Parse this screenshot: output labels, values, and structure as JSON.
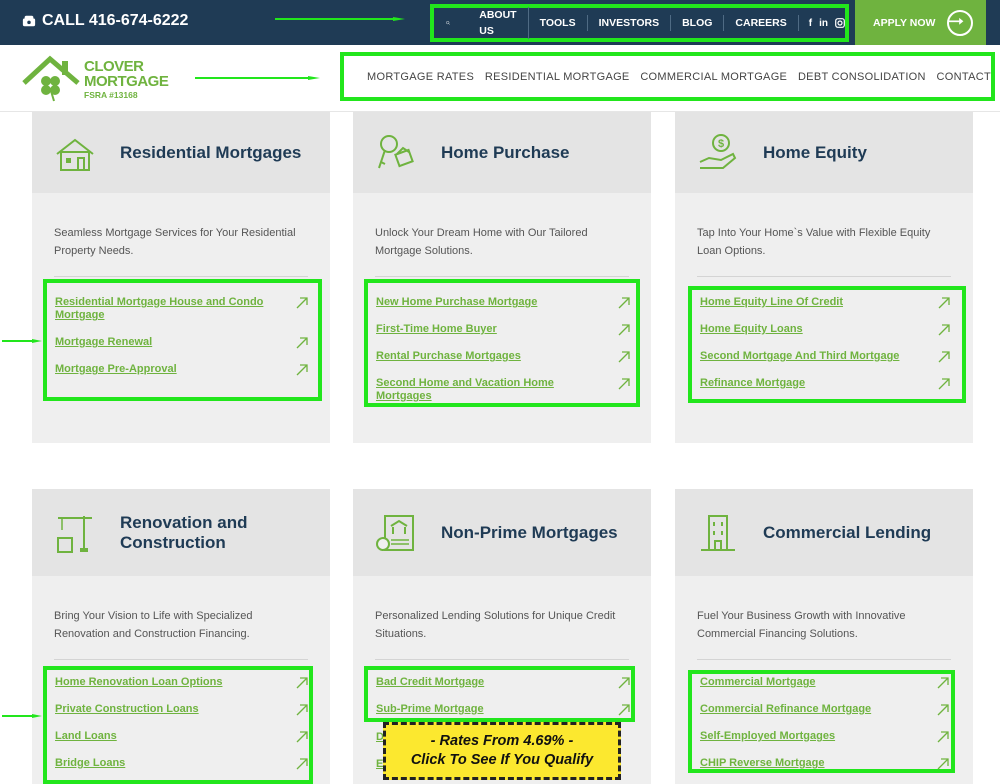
{
  "topbar": {
    "call": "CALL 416-674-6222",
    "nav": [
      "ABOUT US",
      "TOOLS",
      "INVESTORS",
      "BLOG",
      "CAREERS"
    ],
    "social": [
      "f",
      "in",
      "ig"
    ],
    "apply": "APPLY NOW"
  },
  "logo": {
    "line1": "CLOVER",
    "line2": "MORTGAGE",
    "fsra": "FSRA #13168"
  },
  "mainnav": [
    "MORTGAGE RATES",
    "RESIDENTIAL MORTGAGE",
    "COMMERCIAL MORTGAGE",
    "DEBT CONSOLIDATION",
    "CONTACT"
  ],
  "cards": [
    {
      "title": "Residential Mortgages",
      "icon": "house-icon",
      "desc": "Seamless Mortgage Services for Your Residential Property Needs.",
      "links": [
        "Residential Mortgage House and Condo Mortgage",
        "Mortgage Renewal",
        "Mortgage Pre-Approval"
      ]
    },
    {
      "title": "Home Purchase",
      "icon": "keys-icon",
      "desc": "Unlock Your Dream Home with Our Tailored Mortgage Solutions.",
      "links": [
        "New Home Purchase Mortgage",
        "First-Time Home Buyer",
        "Rental Purchase Mortgages",
        "Second Home and Vacation Home Mortgages"
      ]
    },
    {
      "title": "Home Equity",
      "icon": "hand-dollar-icon",
      "desc": "Tap Into Your Home`s Value with Flexible Equity Loan Options.",
      "links": [
        "Home Equity Line Of Credit",
        "Home Equity Loans",
        "Second Mortgage And Third Mortgage",
        "Refinance Mortgage"
      ]
    },
    {
      "title1": "Renovation and",
      "title2": "Construction",
      "icon": "crane-icon",
      "desc": "Bring Your Vision to Life with Specialized Renovation and Construction Financing.",
      "links": [
        "Home Renovation Loan Options",
        "Private Construction Loans",
        "Land Loans",
        "Bridge Loans"
      ]
    },
    {
      "title": "Non-Prime Mortgages",
      "icon": "document-bank-icon",
      "desc": "Personalized Lending Solutions for Unique Credit Situations.",
      "links": [
        "Bad Credit Mortgage",
        "Sub-Prime Mortgage",
        "D",
        "E"
      ]
    },
    {
      "title": "Commercial Lending",
      "icon": "building-icon",
      "desc": "Fuel Your Business Growth with Innovative Commercial Financing Solutions.",
      "links": [
        "Commercial Mortgage",
        "Commercial Refinance Mortgage",
        "Self-Employed Mortgages",
        "CHIP Reverse Mortgage"
      ]
    }
  ],
  "promo": {
    "line1": "- Rates From 4.69% -",
    "line2": "Click To See If You Qualify"
  },
  "colors": {
    "navy": "#1f3b55",
    "green": "#6fb33f",
    "highlight": "#22e61c",
    "promo": "#fce82f"
  }
}
